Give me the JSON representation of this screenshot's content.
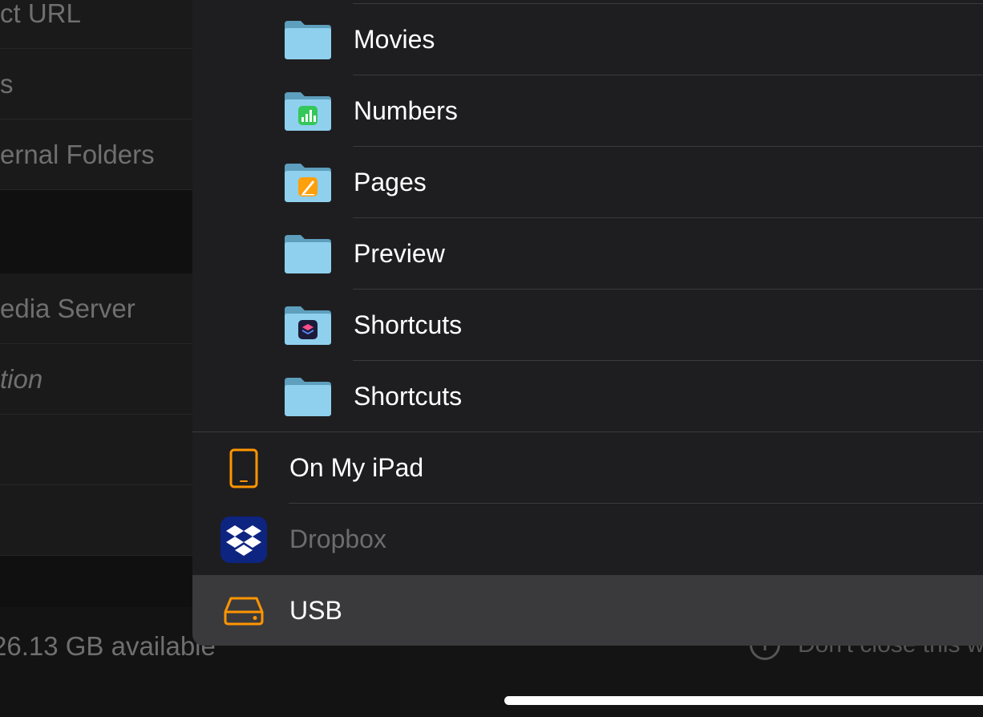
{
  "background": {
    "sidebar_rows": [
      {
        "label": "ct URL",
        "italic": false
      },
      {
        "label": "s",
        "italic": false
      },
      {
        "label": "ernal Folders",
        "italic": false
      },
      {
        "label": "edia Server",
        "italic": false
      },
      {
        "label": "tion",
        "italic": true
      }
    ],
    "storage_text": "26.13 GB available",
    "note_text": "Don't close this w"
  },
  "folders": [
    {
      "label": "Movies",
      "icon": "folder-icon"
    },
    {
      "label": "Numbers",
      "icon": "numbers-folder-icon",
      "badge_color": "#34c759"
    },
    {
      "label": "Pages",
      "icon": "pages-folder-icon",
      "badge_color": "#ff9f0a"
    },
    {
      "label": "Preview",
      "icon": "folder-icon"
    },
    {
      "label": "Shortcuts",
      "icon": "shortcuts-folder-icon"
    },
    {
      "label": "Shortcuts",
      "icon": "folder-icon"
    }
  ],
  "locations": [
    {
      "label": "On My iPad",
      "icon": "ipad-icon",
      "state": "normal"
    },
    {
      "label": "Dropbox",
      "icon": "dropbox-icon",
      "state": "disabled"
    },
    {
      "label": "USB",
      "icon": "usb-drive-icon",
      "state": "selected"
    }
  ],
  "colors": {
    "accent": "#ff9500",
    "folder": "#7fc4e8",
    "dropbox": "#0d2481"
  }
}
